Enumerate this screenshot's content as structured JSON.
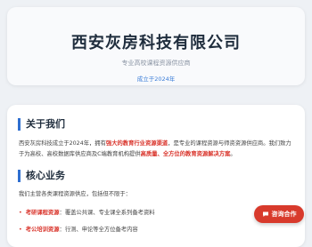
{
  "header": {
    "company_name": "西安灰房科技有限公司",
    "tagline": "专业高校课程资源供应商",
    "founded": "成立于2024年"
  },
  "about": {
    "title": "关于我们",
    "text_1": "西安灰房科技成立于2024年，拥有",
    "highlight_1": "强大的教育行业资源渠道",
    "text_2": "，是专业的课程资源与师资资源供应商。我们致力于为高校、高校数据库供应商及C端教育机构提供",
    "highlight_2": "高质量、全方位的教育资源解决方案",
    "text_3": "。"
  },
  "business": {
    "title": "核心业务",
    "intro": "我们主营各类课程资源供应，包括但不限于：",
    "items": [
      {
        "bullet": "•",
        "name": "考研课程资源",
        "desc": "：覆盖公共课、专业课全系列备考资料"
      },
      {
        "bullet": "•",
        "name": "考公培训资源",
        "desc": "：行测、申论等全方位备考内容"
      }
    ]
  },
  "contact_button": {
    "label": "咨询合作",
    "icon": "chat-icon"
  }
}
